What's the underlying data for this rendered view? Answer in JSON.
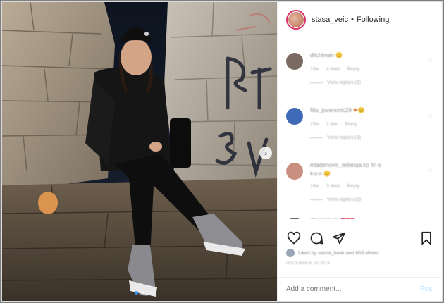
{
  "header": {
    "username": "stasa_veic",
    "separator": "•",
    "follow_status": "Following"
  },
  "comments": [
    {
      "name": "dlichiman",
      "emoji": "😊",
      "meta": [
        "10w",
        "4 likes",
        "Reply"
      ],
      "replies": "View replies (3)",
      "avatar_color": "#7a6a62"
    },
    {
      "name": "filip_jovanovic29",
      "emoji": "❤😊",
      "meta": [
        "10w",
        "1 like",
        "Reply"
      ],
      "replies": "View replies (3)",
      "avatar_color": "#3f6ab8"
    },
    {
      "name": "mladenovic_milenaa",
      "text_line_2": "kuca 😊",
      "text_line_1_suffix": "ko fin e",
      "meta": [
        "10w",
        "3 likes",
        "Reply"
      ],
      "replies": "View replies (3)",
      "avatar_color": "#c99080"
    },
    {
      "name": "draganoviic",
      "emoji": "❤❤❤",
      "meta": [],
      "replies": "",
      "avatar_color": "#5a6a70"
    }
  ],
  "liked_by": "Liked by sasha_baak and 663 others",
  "date": "DECEMBER 16 2019",
  "add_comment": {
    "placeholder": "Add a comment...",
    "post_label": "Post"
  },
  "colors": {
    "link_blue": "#3897f0",
    "post_disabled": "#b2dffc",
    "story_ring": "#e1306c"
  },
  "icons": {
    "like": "heart-icon",
    "comment": "comment-bubble-icon",
    "share": "paper-plane-icon",
    "save": "bookmark-icon",
    "next": "chevron-right-icon"
  }
}
